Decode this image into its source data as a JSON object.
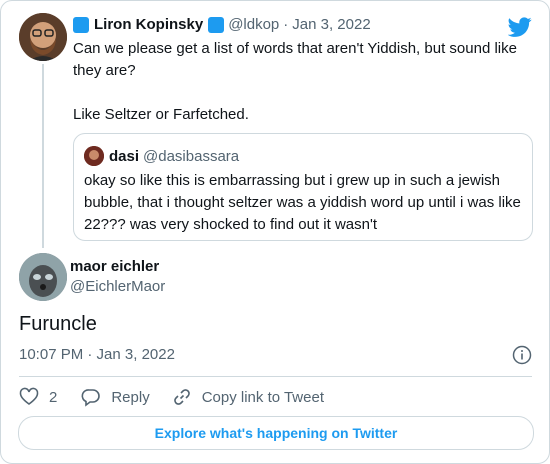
{
  "parent_tweet": {
    "author_name": "Liron Kopinsky",
    "author_handle": "@ldkop",
    "separator": "·",
    "date": "Jan 3, 2022",
    "text_line1": "Can we please get a list of words that aren't Yiddish, but sound like they are?",
    "text_line2": "Like Seltzer or Farfetched."
  },
  "quoted_tweet": {
    "author_name": "dasi",
    "author_handle": "@dasibassara",
    "text": "okay so like this is embarrassing but i grew up in such a jewish bubble, that i thought seltzer was a yiddish word up until i was like 22???  was very shocked to find out it wasn't"
  },
  "main_tweet": {
    "author_name": "maor eichler",
    "author_handle": "@EichlerMaor",
    "text": "Furuncle",
    "timestamp": "10:07 PM · Jan 3, 2022"
  },
  "actions": {
    "like_count": "2",
    "reply_label": "Reply",
    "copy_link_label": "Copy link to Tweet"
  },
  "explore_label": "Explore what's happening on Twitter",
  "colors": {
    "accent": "#1d9bf0",
    "secondary_text": "#536471",
    "border": "#cfd9de"
  }
}
